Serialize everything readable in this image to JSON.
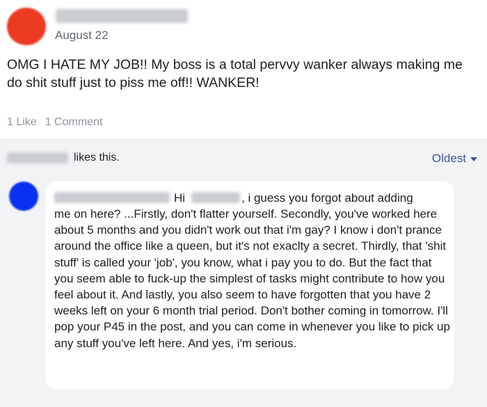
{
  "post": {
    "date": "August 22",
    "text": "OMG I HATE MY JOB!! My boss is a total pervvy wanker always making me do shit stuff just to piss me off!! WANKER!",
    "likes": "1 Like",
    "comments": "1 Comment"
  },
  "reactions": {
    "likes_text": "likes this.",
    "sort_label": "Oldest"
  },
  "comment": {
    "greeting": "Hi",
    "greeting_tail": ", i guess you forgot about adding",
    "body": "me on here? ...Firstly, don't flatter yourself. Secondly, you've worked here about 5 months and you didn't work out that i'm gay? I know i don't prance around the office like a queen, but it's not exaclty a secret. Thirdly, that 'shit stuff' is called your 'job', you know, what i pay you to do. But the fact that you seem able to fuck-up the simplest of tasks might contribute to how you feel about it. And lastly, you also seem to have forgotten that you have 2 weeks left on your 6 month trial period. Don't bother coming in tomorrow. I'll pop your P45 in the post, and you can come in whenever you like to pick up any stuff you've left here. And yes, i'm serious."
  },
  "colors": {
    "poster_avatar": "#ec3a22",
    "commenter_avatar": "#0b31f0",
    "link": "#385898",
    "comments_bg": "#f2f3f5"
  }
}
